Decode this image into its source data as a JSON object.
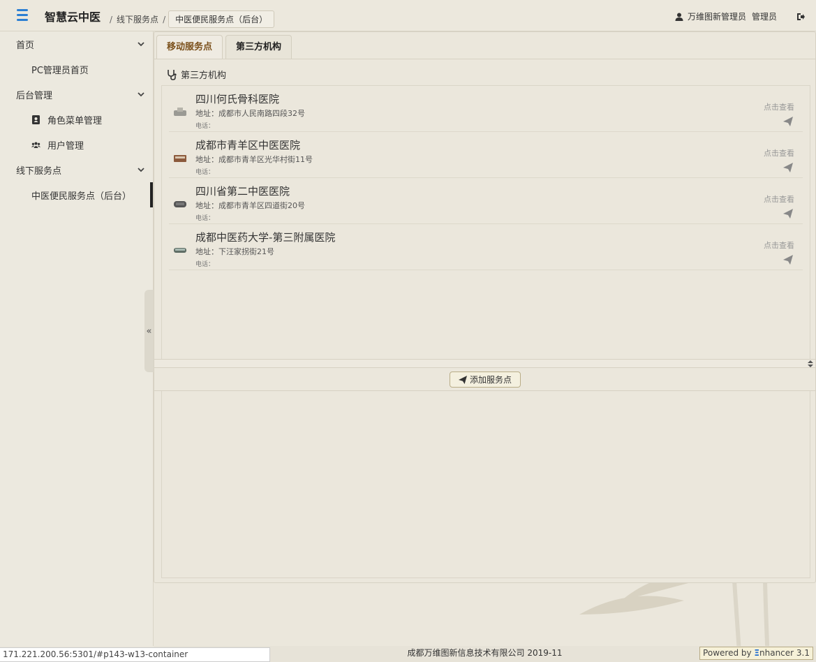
{
  "header": {
    "app_title": "智慧云中医",
    "breadcrumb": {
      "sep1": "/",
      "item1": "线下服务点",
      "sep2": "/",
      "current": "中医便民服务点（后台）"
    },
    "user_name": "万维图新管理员",
    "user_role": "管理员"
  },
  "sidebar": {
    "groups": [
      {
        "label": "首页",
        "items": [
          {
            "label": "PC管理员首页",
            "icon": ""
          }
        ]
      },
      {
        "label": "后台管理",
        "items": [
          {
            "label": "角色菜单管理",
            "icon": "contact-card-icon"
          },
          {
            "label": "用户管理",
            "icon": "users-icon"
          }
        ]
      },
      {
        "label": "线下服务点",
        "items": [
          {
            "label": "中医便民服务点（后台）",
            "icon": ""
          }
        ]
      }
    ],
    "collapse_glyph": "«"
  },
  "main": {
    "tabs": [
      {
        "label": "移动服务点"
      },
      {
        "label": "第三方机构"
      }
    ],
    "section_title": "第三方机构",
    "rows": [
      {
        "name": "四川何氏骨科医院",
        "address": "地址：成都市人民南路四段32号",
        "phone": "电话：",
        "view": "点击查看"
      },
      {
        "name": "成都市青羊区中医医院",
        "address": "地址：成都市青羊区光华村街11号",
        "phone": "电话：",
        "view": "点击查看"
      },
      {
        "name": "四川省第二中医医院",
        "address": "地址：成都市青羊区四道街20号",
        "phone": "电话：",
        "view": "点击查看"
      },
      {
        "name": "成都中医药大学-第三附属医院",
        "address": "地址：下汪家拐街21号",
        "phone": "电话：",
        "view": "点击查看"
      }
    ],
    "add_button": "添加服务点"
  },
  "footer": {
    "copyright": "成都万维图新信息技术有限公司 2019-11",
    "status_url": "171.221.200.56:5301/#p143-w13-container",
    "powered_prefix": "Powered by ",
    "powered_mark": "Ξ",
    "powered_suffix": "nhancer 3.1"
  },
  "colors": {
    "accent_blue": "#2c7fd3",
    "tab_inactive_text": "#7a4f1a",
    "page_bg": "#ebe7dc"
  }
}
